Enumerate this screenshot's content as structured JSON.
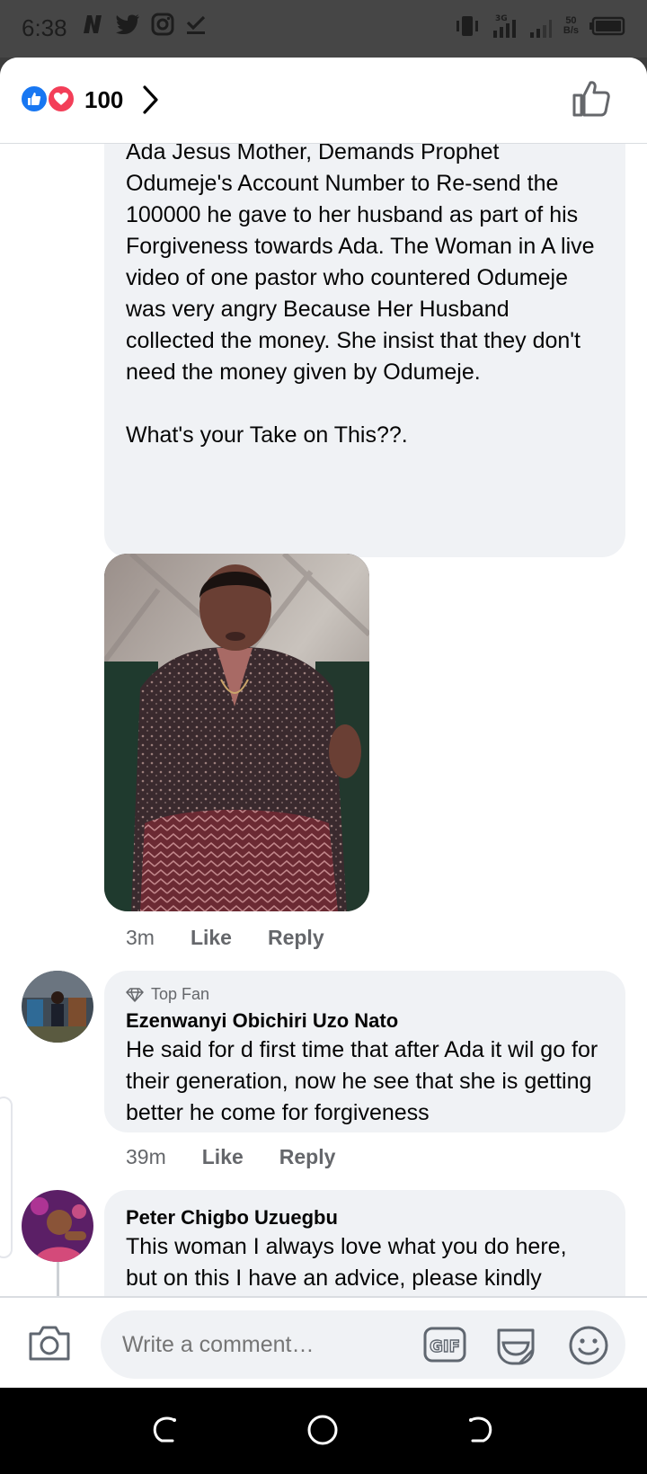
{
  "status_bar": {
    "time": "6:38",
    "net_speed_value": "50",
    "net_speed_unit": "B/s",
    "network_type": "3G"
  },
  "header": {
    "reaction_count": "100",
    "reactions": [
      "like-icon",
      "love-icon"
    ]
  },
  "post": {
    "text": "Ada Jesus Mother, Demands Prophet Odumeje's Account Number to Re-send the 100000 he gave to her husband as part of his Forgiveness towards Ada. The Woman in A live video of one pastor who countered Odumeje was very angry Because Her Husband collected the money. She insist that they don't need the money given by Odumeje.\n\nWhat's your Take on This??.",
    "time": "3m",
    "like_label": "Like",
    "reply_label": "Reply"
  },
  "comments": [
    {
      "badge": "Top Fan",
      "author": "Ezenwanyi Obichiri Uzo Nato",
      "text": "He said for d first time that after Ada it wil go for their generation, now he see that she is getting better he come for forgiveness",
      "time": "39m",
      "like_label": "Like",
      "reply_label": "Reply"
    },
    {
      "author": "Peter Chigbo Uzuegbu",
      "text": "This woman I always love what you do here, but on this I have an advice, please kindly worship your God not worshiping pastors, be wise"
    }
  ],
  "composer": {
    "placeholder": "Write a comment…",
    "gif_label": "GIF"
  },
  "colors": {
    "like_blue": "#1877f2",
    "love_red": "#f33e58",
    "bubble_bg": "#f0f2f5",
    "secondary_text": "#65676b"
  }
}
